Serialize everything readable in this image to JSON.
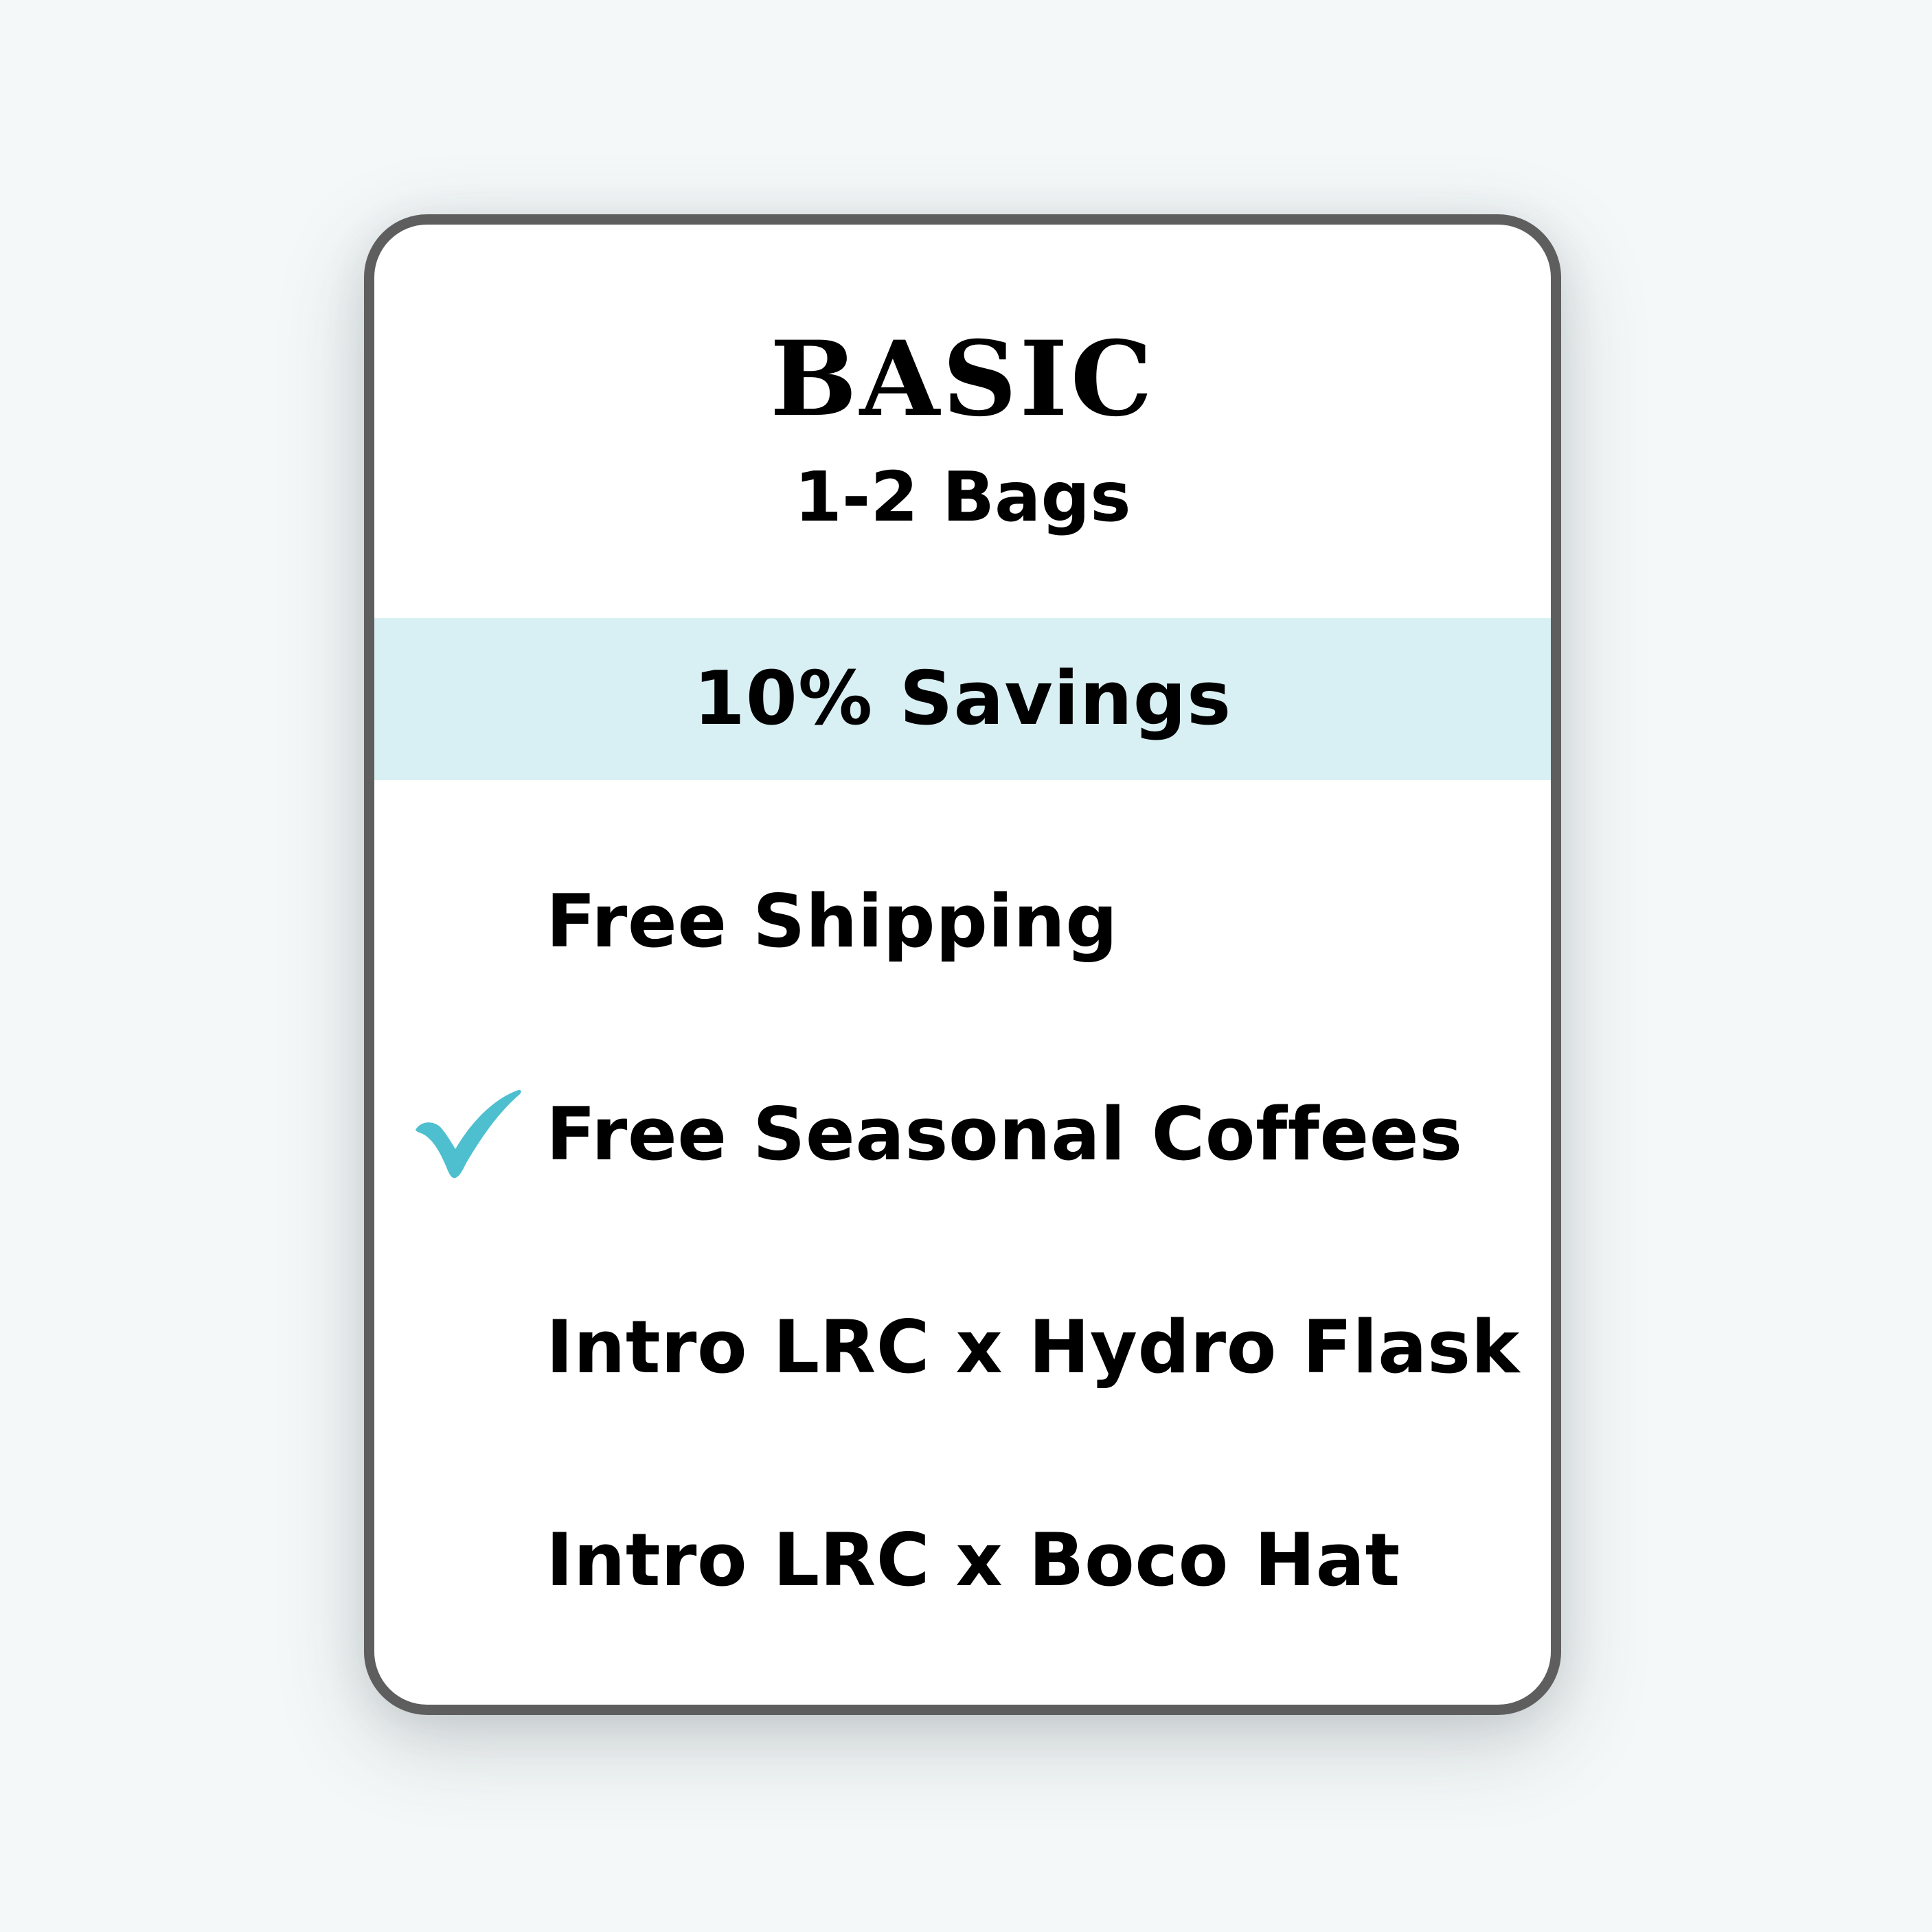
{
  "plan": {
    "name": "BASIC",
    "subtitle": "1-2 Bags",
    "savings": "10% Savings"
  },
  "features": [
    {
      "label": "Free Shipping",
      "checked": false
    },
    {
      "label": "Free Seasonal Coffees",
      "checked": true,
      "icon": "checkmark-icon"
    },
    {
      "label": "Intro LRC x Hydro Flask",
      "checked": false
    },
    {
      "label": "Intro LRC x Boco Hat",
      "checked": false
    }
  ],
  "colors": {
    "page_background": "#f4f8f9",
    "card_border": "#5e5e5e",
    "savings_band": "#d8f0f4",
    "checkmark": "#4dbfcf",
    "text": "#000000"
  }
}
